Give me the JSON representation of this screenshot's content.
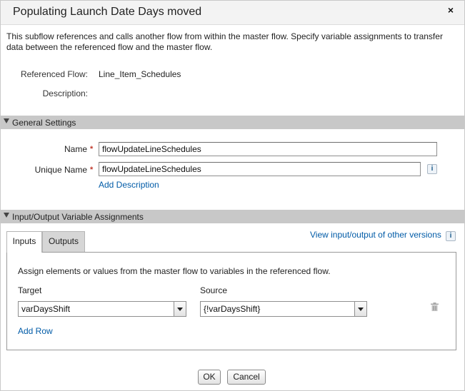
{
  "dialog": {
    "title": "Populating Launch Date Days moved",
    "close_glyph": "×",
    "close_icon": "close-icon"
  },
  "intro_text": "This subflow references and calls another flow from within the master flow. Specify variable assignments to transfer data between the referenced flow and the master flow.",
  "details": {
    "referenced_flow_label": "Referenced Flow:",
    "referenced_flow_value": "Line_Item_Schedules",
    "description_label": "Description:",
    "description_value": ""
  },
  "general_settings": {
    "section_title": "General Settings",
    "name_label": "Name",
    "name_value": "flowUpdateLineSchedules",
    "unique_name_label": "Unique Name",
    "unique_name_value": "flowUpdateLineSchedules",
    "required_marker": "*",
    "info_glyph": "i",
    "add_description_link": "Add Description"
  },
  "io_assignments": {
    "section_title": "Input/Output Variable Assignments",
    "view_other_versions_link": "View input/output of other versions",
    "tabs": [
      {
        "label": "Inputs",
        "active": true
      },
      {
        "label": "Outputs",
        "active": false
      }
    ],
    "instruction": "Assign elements or values from the master flow to variables in the referenced flow.",
    "target_header": "Target",
    "source_header": "Source",
    "rows": [
      {
        "target": "varDaysShift",
        "source": "{!varDaysShift}"
      }
    ],
    "add_row_link": "Add Row"
  },
  "footer": {
    "ok_label": "OK",
    "cancel_label": "Cancel"
  },
  "colors": {
    "link": "#015ba7",
    "section_bar": "#c8c8c8",
    "required": "#c0392b"
  }
}
